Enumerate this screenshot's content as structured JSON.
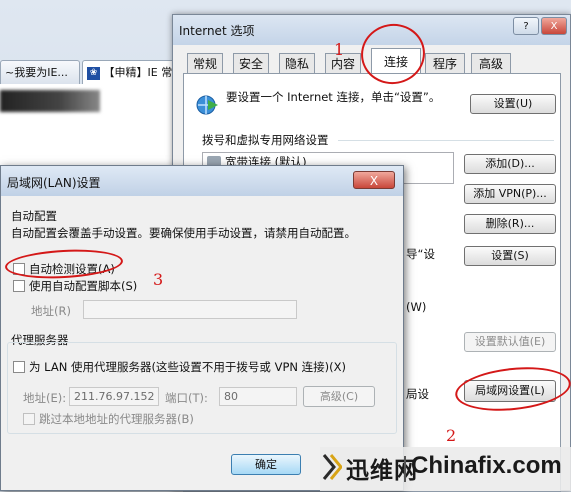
{
  "browser": {
    "tabs": [
      {
        "label": "~我要为IE..."
      },
      {
        "label": "【申精】IE 常"
      }
    ]
  },
  "internet_options": {
    "title": "Internet 选项",
    "help_glyph": "?",
    "close_glyph": "X",
    "tabs": [
      "常规",
      "安全",
      "隐私",
      "内容",
      "连接",
      "程序",
      "高级"
    ],
    "active_tab": "连接",
    "setup_text": "要设置一个 Internet 连接，单击“设置”。",
    "setup_button": "设置(U)",
    "dialup_group_label": "拨号和虚拟专用网络设置",
    "connection_item": "宽带连接 (默认)",
    "add_button": "添加(D)...",
    "add_vpn_button": "添加 VPN(P)...",
    "delete_button": "删除(R)...",
    "settings_button": "设置(S)",
    "set_default_button": "设置默认值(E)",
    "lan_settings_button": "局域网设置(L)",
    "partial_text_1": "导“设",
    "partial_text_2": "(W)",
    "partial_text_3": "局设"
  },
  "lan_dialog": {
    "title": "局域网(LAN)设置",
    "close_glyph": "X",
    "auto_config_header": "自动配置",
    "auto_config_desc": "自动配置会覆盖手动设置。要确保使用手动设置，请禁用自动配置。",
    "auto_detect_label": "自动检测设置(A)",
    "auto_detect_checked": false,
    "use_script_label": "使用自动配置脚本(S)",
    "use_script_checked": false,
    "address_label": "地址(R)",
    "proxy_group_label": "代理服务器",
    "use_proxy_label": "为 LAN 使用代理服务器(这些设置不用于拨号或 VPN 连接)(X)",
    "use_proxy_checked": false,
    "proxy_address_label": "地址(E):",
    "proxy_address_value": "211.76.97.152",
    "port_label": "端口(T):",
    "port_value": "80",
    "advanced_button": "高级(C)",
    "bypass_label": "跳过本地地址的代理服务器(B)",
    "ok_button": "确定"
  },
  "annotations": [
    "1",
    "2",
    "3"
  ],
  "watermark": {
    "cn": "迅维网",
    "en": "Chinafix.com"
  },
  "colors": {
    "annotation": "#d41818",
    "accent": "#3c7fb1"
  }
}
